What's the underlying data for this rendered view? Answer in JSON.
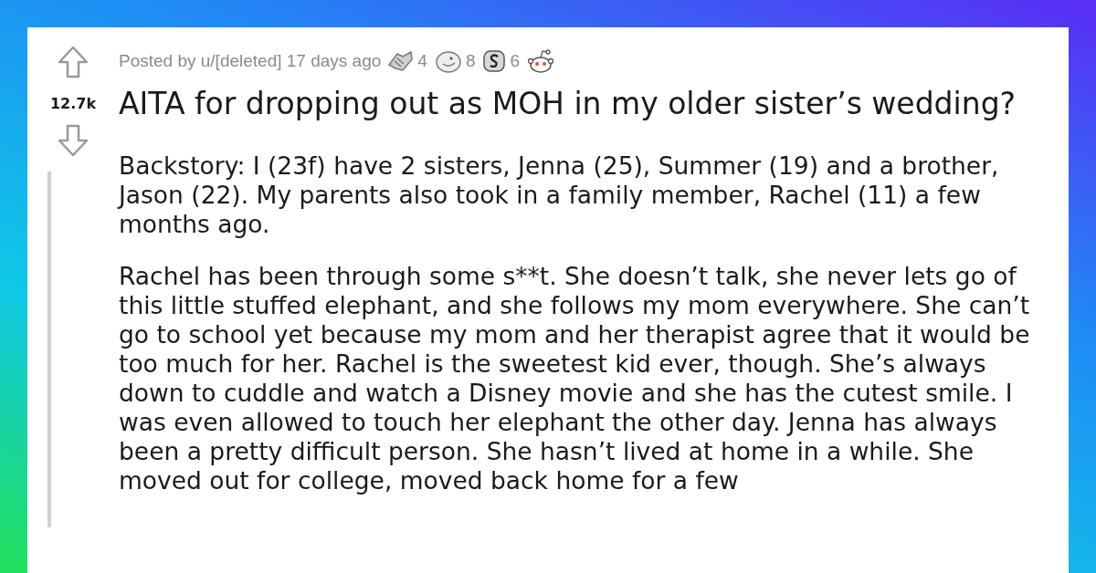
{
  "post": {
    "score": "12.7k",
    "byline": "Posted by u/[deleted] 17 days ago",
    "awards": [
      {
        "kind": "handshake",
        "count": "4"
      },
      {
        "kind": "face",
        "count": "8"
      },
      {
        "kind": "coin",
        "count": "6"
      },
      {
        "kind": "alien"
      }
    ],
    "title": "AITA for dropping out as MOH in my older sister’s wedding?",
    "paragraphs": [
      "Backstory: I (23f) have 2 sisters, Jenna (25), Summer (19) and a brother, Jason (22). My parents also took in a family member, Rachel (11) a few months ago.",
      "Rachel has been through some s**t. She doesn’t talk, she never lets go of this little stuffed elephant, and she follows my mom everywhere. She can’t go to school yet because my mom and her therapist agree that it would be too much for her. Rachel is the sweetest kid ever, though. She’s always down to cuddle and watch a Disney movie and she has the cutest smile. I was even allowed to touch her elephant the other day. Jenna has always been a pretty difficult person. She hasn’t lived at home in a while. She moved out for college, moved back home for a few"
    ]
  }
}
